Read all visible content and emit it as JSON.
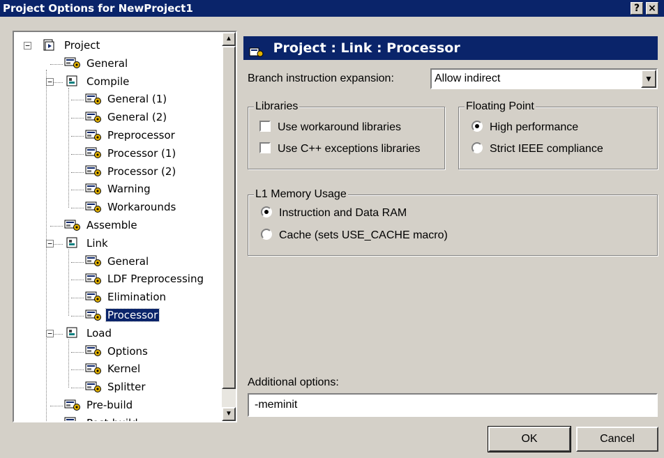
{
  "window": {
    "title": "Project Options for NewProject1",
    "help_label": "?",
    "close_label": "×"
  },
  "tree": {
    "items": [
      {
        "label": "Project",
        "icon": "project-icon"
      },
      {
        "label": "General",
        "icon": "page-icon"
      },
      {
        "label": "Compile",
        "icon": "folder-icon"
      },
      {
        "label": "General (1)",
        "icon": "page-icon"
      },
      {
        "label": "General (2)",
        "icon": "page-icon"
      },
      {
        "label": "Preprocessor",
        "icon": "page-icon"
      },
      {
        "label": "Processor (1)",
        "icon": "page-icon"
      },
      {
        "label": "Processor (2)",
        "icon": "page-icon"
      },
      {
        "label": "Warning",
        "icon": "page-icon"
      },
      {
        "label": "Workarounds",
        "icon": "page-icon"
      },
      {
        "label": "Assemble",
        "icon": "page-icon"
      },
      {
        "label": "Link",
        "icon": "folder-icon"
      },
      {
        "label": "General",
        "icon": "page-icon"
      },
      {
        "label": "LDF Preprocessing",
        "icon": "page-icon"
      },
      {
        "label": "Elimination",
        "icon": "page-icon"
      },
      {
        "label": "Processor",
        "icon": "page-icon",
        "selected": true
      },
      {
        "label": "Load",
        "icon": "folder-icon"
      },
      {
        "label": "Options",
        "icon": "page-icon"
      },
      {
        "label": "Kernel",
        "icon": "page-icon"
      },
      {
        "label": "Splitter",
        "icon": "page-icon"
      },
      {
        "label": "Pre-build",
        "icon": "page-icon"
      },
      {
        "label": "Post-build",
        "icon": "page-icon"
      }
    ]
  },
  "page": {
    "header": "Project : Link : Processor",
    "branch_label": "Branch instruction expansion:",
    "branch_value": "Allow indirect",
    "libraries": {
      "title": "Libraries",
      "workaround": "Use workaround libraries",
      "cpp_exceptions": "Use C++ exceptions libraries"
    },
    "floating_point": {
      "title": "Floating Point",
      "high_performance": "High performance",
      "strict_ieee": "Strict IEEE compliance"
    },
    "l1_memory": {
      "title": "L1 Memory Usage",
      "instruction_ram": "Instruction and Data RAM",
      "cache": "Cache (sets USE_CACHE macro)"
    },
    "additional_label": "Additional options:",
    "additional_value": "-meminit"
  },
  "buttons": {
    "ok": "OK",
    "cancel": "Cancel"
  }
}
